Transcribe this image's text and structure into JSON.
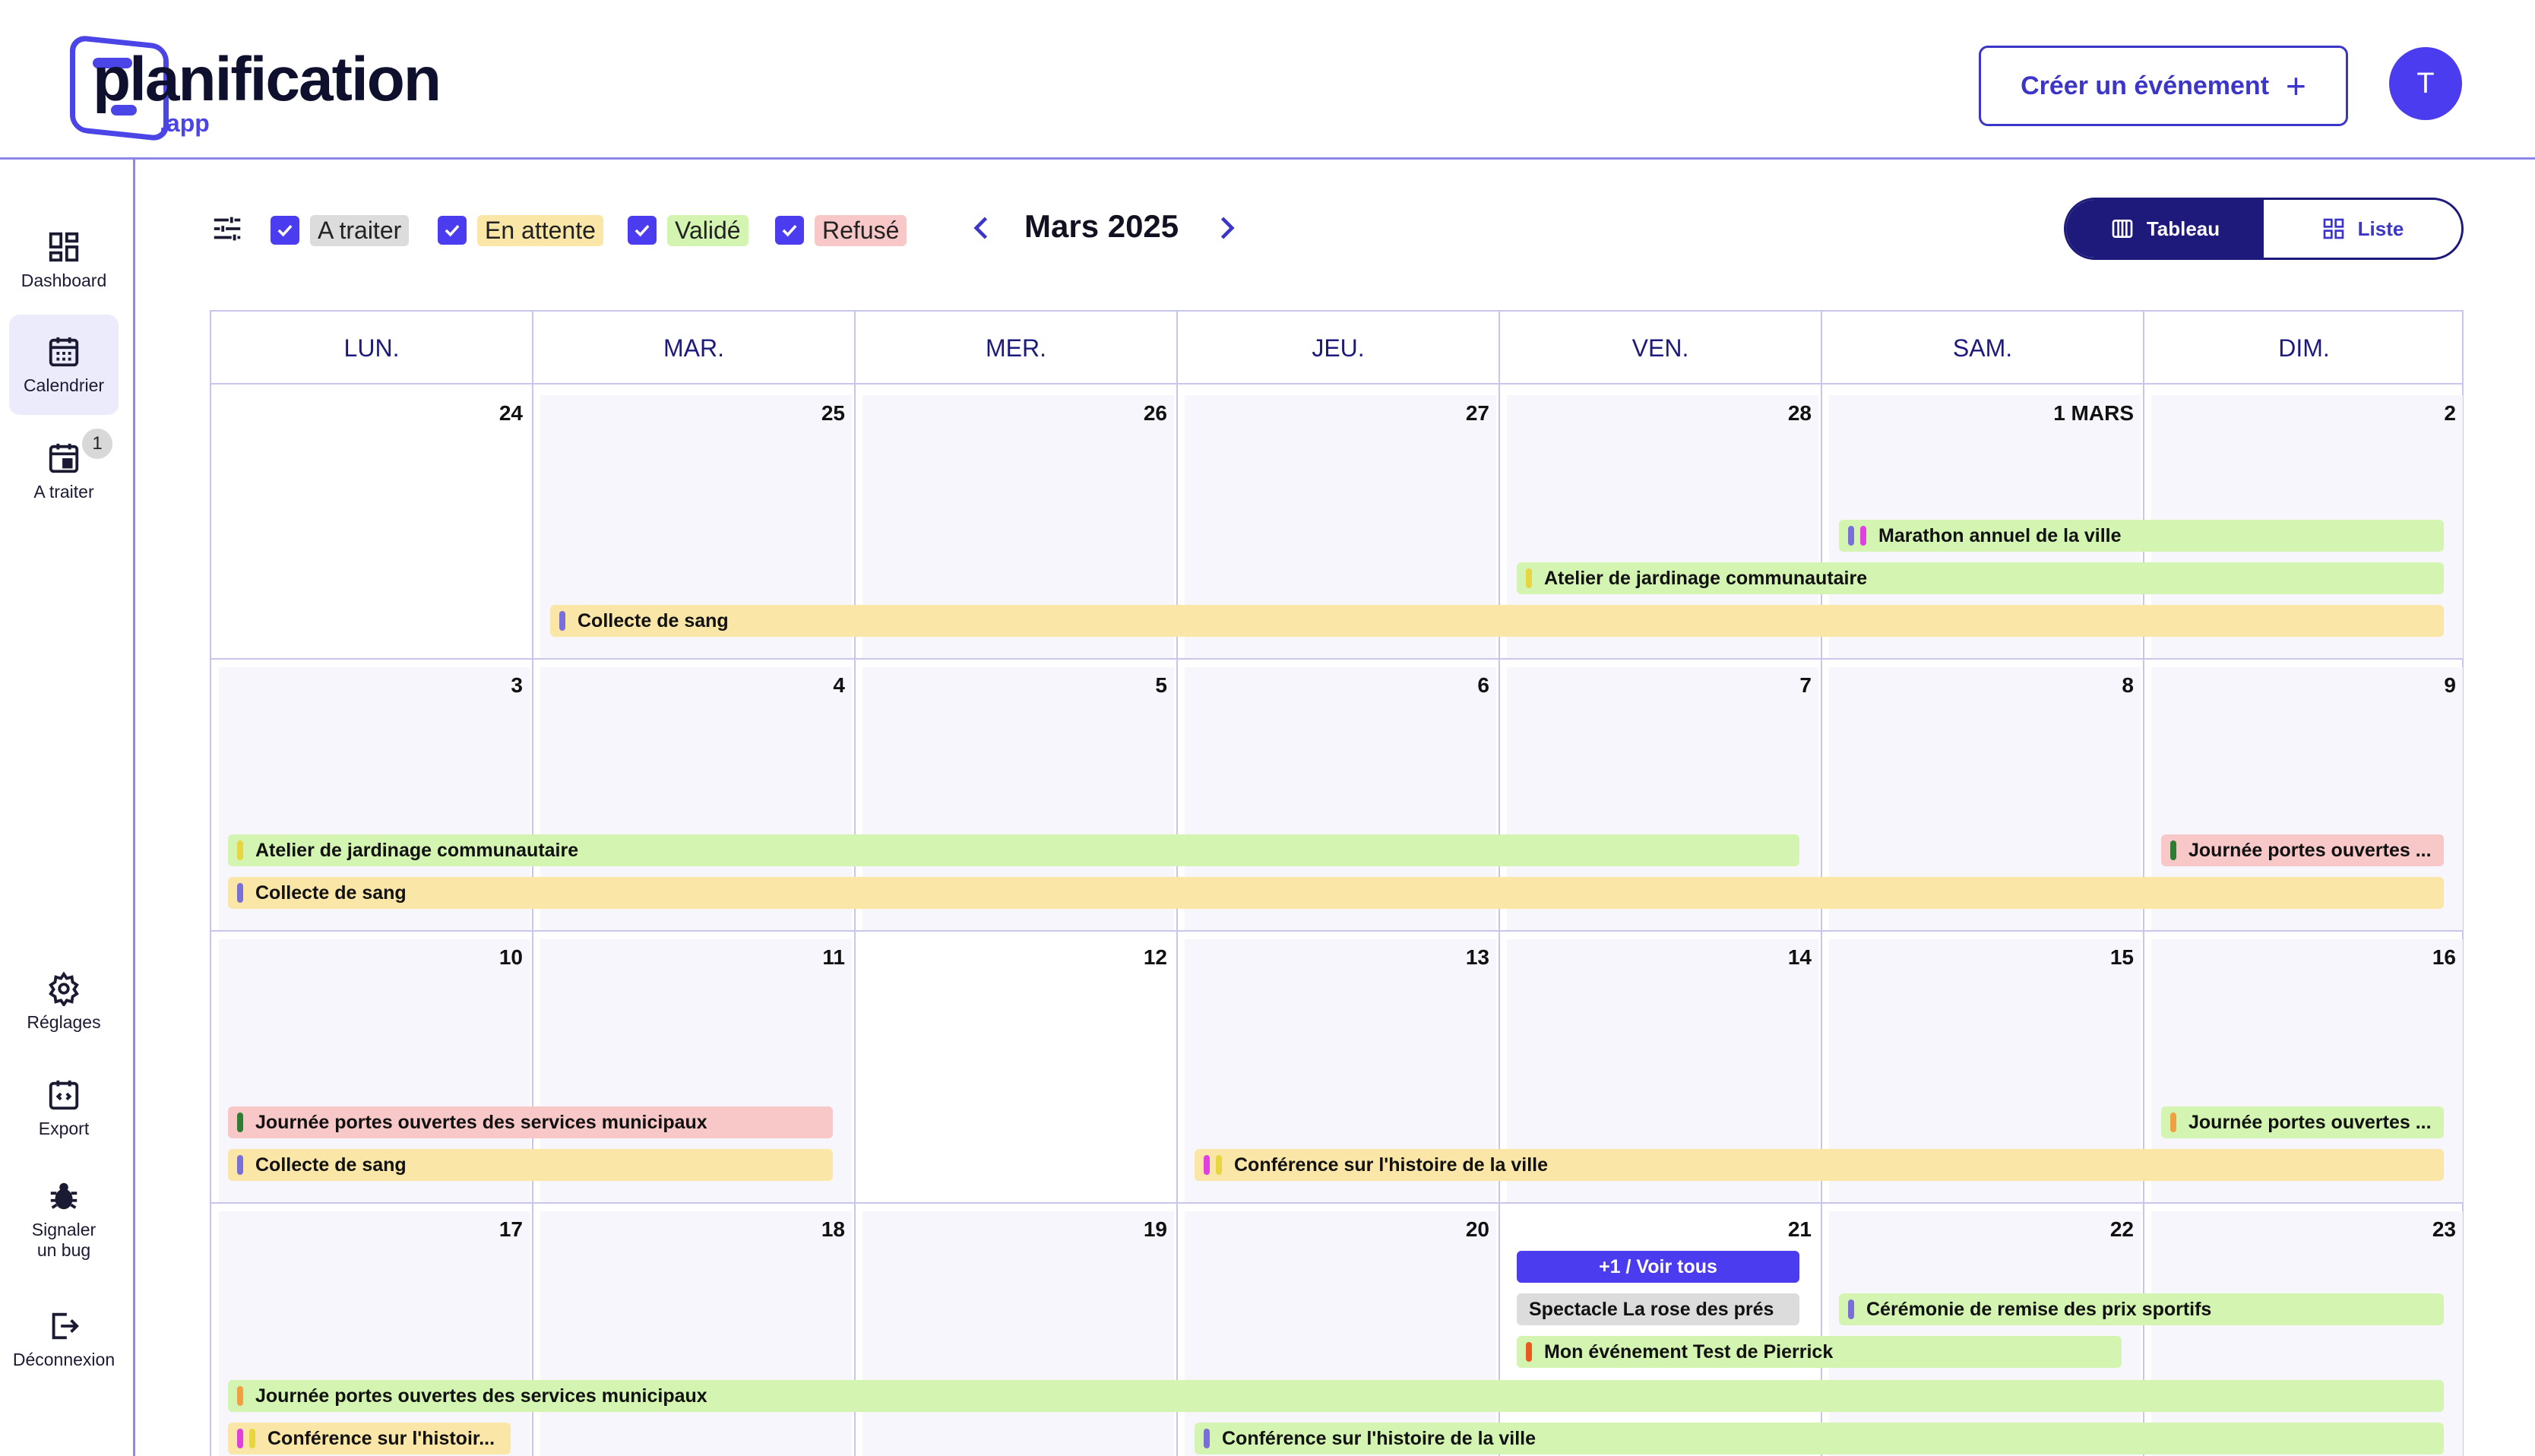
{
  "app": {
    "logo_text": "planification",
    "logo_sub": ".app"
  },
  "header": {
    "create_label": "Créer un événement",
    "create_plus": "+",
    "avatar_initial": "T"
  },
  "sidebar": {
    "items": [
      {
        "label": "Dashboard"
      },
      {
        "label": "Calendrier"
      },
      {
        "label": "A traiter",
        "badge": "1"
      },
      {
        "label": "Réglages"
      },
      {
        "label": "Export"
      },
      {
        "label": "Signaler un bug"
      },
      {
        "label": "Déconnexion"
      }
    ]
  },
  "filters": [
    {
      "label": "A traiter",
      "color": "#dcdcdc"
    },
    {
      "label": "En attente",
      "color": "#fae6a6"
    },
    {
      "label": "Validé",
      "color": "#d4f5b2"
    },
    {
      "label": "Refusé",
      "color": "#f8c8c8"
    }
  ],
  "calendar": {
    "month_title": "Mars 2025",
    "weekdays": [
      "LUN.",
      "MAR.",
      "MER.",
      "JEU.",
      "VEN.",
      "SAM.",
      "DIM."
    ],
    "weeks": [
      [
        "24",
        "25",
        "26",
        "27",
        "28",
        "1 MARS",
        "2"
      ],
      [
        "3",
        "4",
        "5",
        "6",
        "7",
        "8",
        "9"
      ],
      [
        "10",
        "11",
        "12",
        "13",
        "14",
        "15",
        "16"
      ],
      [
        "17",
        "18",
        "19",
        "20",
        "21",
        "22",
        "23"
      ]
    ],
    "events": [
      {
        "label": "Marathon annuel de la ville"
      },
      {
        "label": "Atelier de jardinage communautaire"
      },
      {
        "label": "Collecte de sang"
      },
      {
        "label": "Atelier de jardinage communautaire"
      },
      {
        "label": "Journée portes ouvertes ..."
      },
      {
        "label": "Collecte de sang"
      },
      {
        "label": "Journée portes ouvertes des services municipaux"
      },
      {
        "label": "Journée portes ouvertes ..."
      },
      {
        "label": "Collecte de sang"
      },
      {
        "label": "Conférence sur l'histoire de la ville"
      },
      {
        "label": "+1 / Voir tous"
      },
      {
        "label": "Spectacle La rose des prés"
      },
      {
        "label": "Cérémonie de remise des prix sportifs"
      },
      {
        "label": "Mon événement Test de Pierrick"
      },
      {
        "label": "Journée portes ouvertes des services municipaux"
      },
      {
        "label": "Conférence sur l'histoir..."
      },
      {
        "label": "Conférence sur l'histoire de la ville"
      }
    ]
  },
  "view_toggle": {
    "tableau": "Tableau",
    "liste": "Liste"
  },
  "colors": {
    "accent": "#4b3cf0",
    "dark_accent": "#1e1a7c",
    "border": "#8b86e8"
  }
}
